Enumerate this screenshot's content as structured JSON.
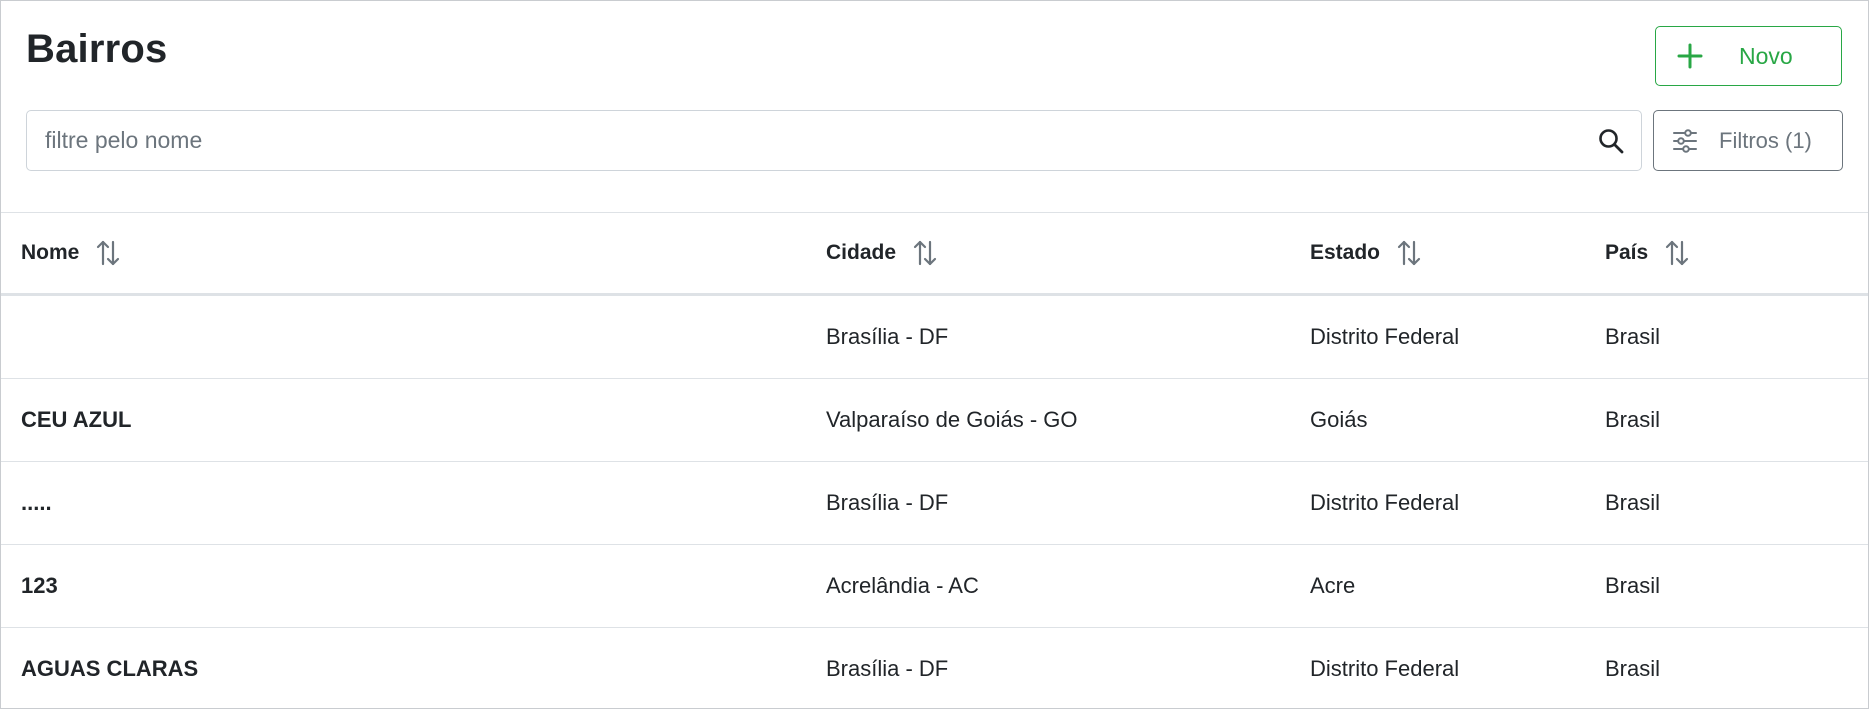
{
  "page": {
    "title": "Bairros"
  },
  "actions": {
    "new_label": "Novo",
    "filters_label": "Filtros (1)"
  },
  "search": {
    "placeholder": "filtre pelo nome",
    "value": ""
  },
  "table": {
    "columns": [
      "Nome",
      "Cidade",
      "Estado",
      "País"
    ],
    "rows": [
      {
        "nome": "",
        "cidade": "Brasília - DF",
        "estado": "Distrito Federal",
        "pais": "Brasil"
      },
      {
        "nome": "CEU AZUL",
        "cidade": "Valparaíso de Goiás - GO",
        "estado": "Goiás",
        "pais": "Brasil"
      },
      {
        "nome": ".....",
        "cidade": "Brasília - DF",
        "estado": "Distrito Federal",
        "pais": "Brasil"
      },
      {
        "nome": "123",
        "cidade": "Acrelândia - AC",
        "estado": "Acre",
        "pais": "Brasil"
      },
      {
        "nome": "AGUAS CLARAS",
        "cidade": "Brasília - DF",
        "estado": "Distrito Federal",
        "pais": "Brasil"
      }
    ]
  },
  "icons": {
    "new": "plus-icon",
    "search": "search-icon",
    "filters": "sliders-icon",
    "sort": "sort-arrows-icon"
  },
  "colors": {
    "success": "#28a745",
    "secondary": "#6c757d",
    "text": "#212529",
    "border": "#dee2e6"
  }
}
